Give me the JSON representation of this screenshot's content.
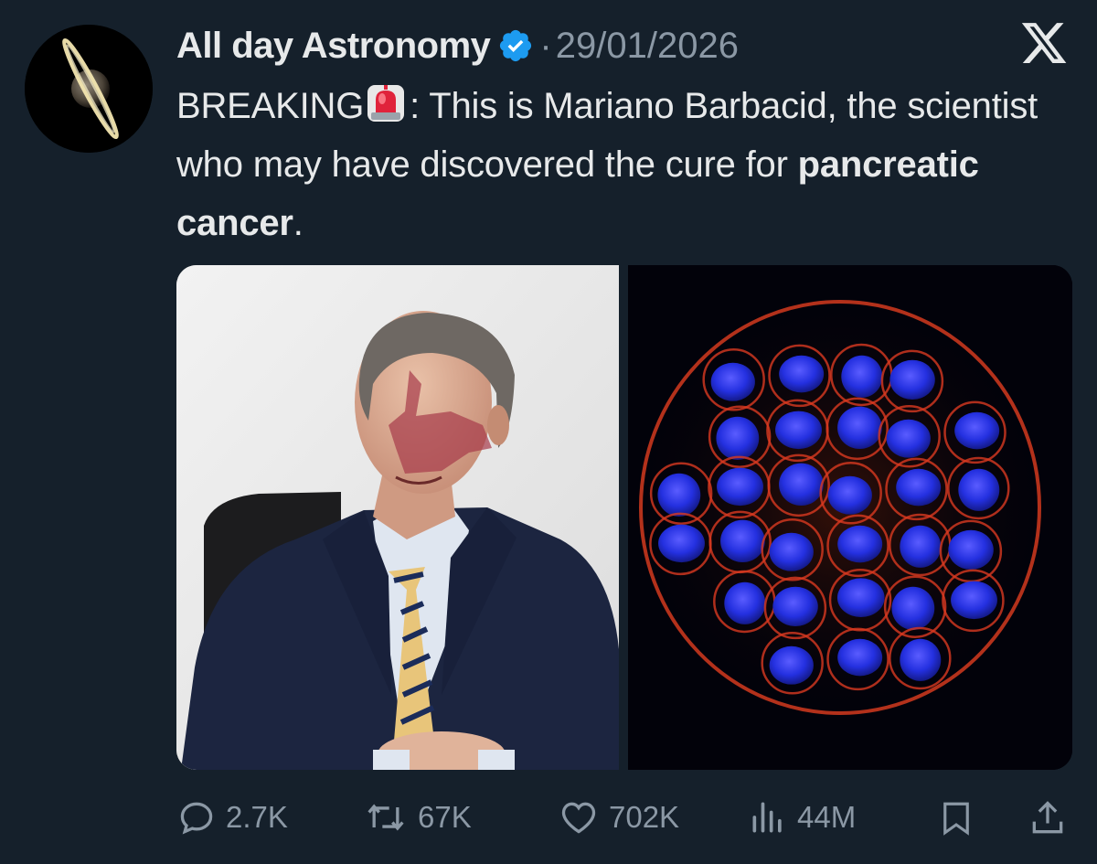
{
  "tweet": {
    "author_name": "All day Astronomy",
    "separator": "·",
    "date": "29/01/2026",
    "text_prefix": "BREAKING",
    "text_main": ": This is Mariano Barbacid, the scientist who may have discovered the cure for ",
    "text_bold": "pancreatic cancer",
    "text_end": "."
  },
  "media": {
    "left_image": "portrait-of-man-in-suit",
    "right_image": "fluorescent-cell-cluster-microscopy"
  },
  "actions": {
    "replies": "2.7K",
    "reposts": "67K",
    "likes": "702K",
    "views": "44M"
  },
  "icons": {
    "brand": "x-logo-icon",
    "verified": "verified-badge-icon",
    "siren": "siren-emoji-icon",
    "reply": "reply-icon",
    "repost": "repost-icon",
    "like": "heart-icon",
    "views": "views-chart-icon",
    "bookmark": "bookmark-icon",
    "share": "share-icon"
  },
  "colors": {
    "background": "#15202b",
    "text": "#e7e9ea",
    "muted": "#8b98a5",
    "verified": "#1d9bf0"
  }
}
